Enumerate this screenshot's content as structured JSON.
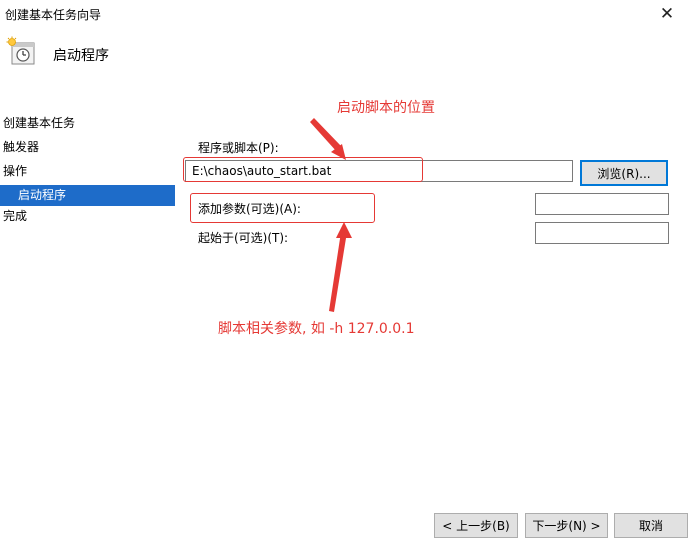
{
  "window": {
    "title": "创建基本任务向导",
    "close_glyph": "✕"
  },
  "header": {
    "title": "启动程序",
    "icon": "calendar-clock-icon"
  },
  "steps": [
    {
      "label": "创建基本任务"
    },
    {
      "label": "触发器"
    },
    {
      "label": "操作"
    },
    {
      "label": "启动程序",
      "active": true
    },
    {
      "label": "完成"
    }
  ],
  "form": {
    "program_label": "程序或脚本(P):",
    "program_value": "E:\\chaos\\auto_start.bat",
    "browse_label": "浏览(R)...",
    "args_label": "添加参数(可选)(A):",
    "args_value": "",
    "startin_label": "起始于(可选)(T):",
    "startin_value": ""
  },
  "annotations": {
    "script_location": "启动脚本的位置",
    "script_args": "脚本相关参数, 如 -h 127.0.0.1",
    "color": "#e53935"
  },
  "footer": {
    "back_label": "< 上一步(B)",
    "next_label": "下一步(N) >",
    "cancel_label": "取消"
  }
}
